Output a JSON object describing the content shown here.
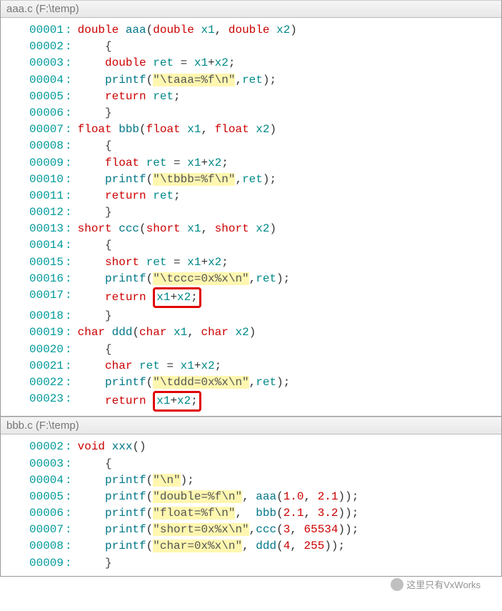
{
  "files": [
    {
      "header": "aaa.c (F:\\temp)",
      "lines": [
        {
          "n": "00001",
          "tokens": [
            {
              "t": "kw",
              "v": "double "
            },
            {
              "t": "fn",
              "v": "aaa"
            },
            {
              "t": "plain",
              "v": "("
            },
            {
              "t": "kw",
              "v": "double "
            },
            {
              "t": "param",
              "v": "x1"
            },
            {
              "t": "plain",
              "v": ", "
            },
            {
              "t": "kw",
              "v": "double "
            },
            {
              "t": "param",
              "v": "x2"
            },
            {
              "t": "plain",
              "v": ")"
            }
          ],
          "indent": 0
        },
        {
          "n": "00002",
          "tokens": [
            {
              "t": "brace",
              "v": "{"
            }
          ],
          "indent": 1
        },
        {
          "n": "00003",
          "tokens": [
            {
              "t": "kw",
              "v": "double "
            },
            {
              "t": "param",
              "v": "ret"
            },
            {
              "t": "plain",
              "v": " = "
            },
            {
              "t": "param",
              "v": "x1"
            },
            {
              "t": "plain",
              "v": "+"
            },
            {
              "t": "param",
              "v": "x2"
            },
            {
              "t": "plain",
              "v": ";"
            }
          ],
          "indent": 1
        },
        {
          "n": "00004",
          "tokens": [
            {
              "t": "fn",
              "v": "printf"
            },
            {
              "t": "plain",
              "v": "("
            },
            {
              "t": "str",
              "v": "\"\\taaa=%f\\n\""
            },
            {
              "t": "plain",
              "v": ","
            },
            {
              "t": "param",
              "v": "ret"
            },
            {
              "t": "plain",
              "v": ");"
            }
          ],
          "indent": 1
        },
        {
          "n": "00005",
          "tokens": [
            {
              "t": "kw",
              "v": "return "
            },
            {
              "t": "param",
              "v": "ret"
            },
            {
              "t": "plain",
              "v": ";"
            }
          ],
          "indent": 1
        },
        {
          "n": "00006",
          "tokens": [
            {
              "t": "brace",
              "v": "}"
            }
          ],
          "indent": 1
        },
        {
          "n": "00007",
          "tokens": [
            {
              "t": "kw",
              "v": "float "
            },
            {
              "t": "fn",
              "v": "bbb"
            },
            {
              "t": "plain",
              "v": "("
            },
            {
              "t": "kw",
              "v": "float "
            },
            {
              "t": "param",
              "v": "x1"
            },
            {
              "t": "plain",
              "v": ", "
            },
            {
              "t": "kw",
              "v": "float "
            },
            {
              "t": "param",
              "v": "x2"
            },
            {
              "t": "plain",
              "v": ")"
            }
          ],
          "indent": 0
        },
        {
          "n": "00008",
          "tokens": [
            {
              "t": "brace",
              "v": "{"
            }
          ],
          "indent": 1
        },
        {
          "n": "00009",
          "tokens": [
            {
              "t": "kw",
              "v": "float "
            },
            {
              "t": "param",
              "v": "ret"
            },
            {
              "t": "plain",
              "v": " = "
            },
            {
              "t": "param",
              "v": "x1"
            },
            {
              "t": "plain",
              "v": "+"
            },
            {
              "t": "param",
              "v": "x2"
            },
            {
              "t": "plain",
              "v": ";"
            }
          ],
          "indent": 1
        },
        {
          "n": "00010",
          "tokens": [
            {
              "t": "fn",
              "v": "printf"
            },
            {
              "t": "plain",
              "v": "("
            },
            {
              "t": "str",
              "v": "\"\\tbbb=%f\\n\""
            },
            {
              "t": "plain",
              "v": ","
            },
            {
              "t": "param",
              "v": "ret"
            },
            {
              "t": "plain",
              "v": ");"
            }
          ],
          "indent": 1
        },
        {
          "n": "00011",
          "tokens": [
            {
              "t": "kw",
              "v": "return "
            },
            {
              "t": "param",
              "v": "ret"
            },
            {
              "t": "plain",
              "v": ";"
            }
          ],
          "indent": 1
        },
        {
          "n": "00012",
          "tokens": [
            {
              "t": "brace",
              "v": "}"
            }
          ],
          "indent": 1
        },
        {
          "n": "00013",
          "tokens": [
            {
              "t": "kw",
              "v": "short "
            },
            {
              "t": "fn",
              "v": "ccc"
            },
            {
              "t": "plain",
              "v": "("
            },
            {
              "t": "kw",
              "v": "short "
            },
            {
              "t": "param",
              "v": "x1"
            },
            {
              "t": "plain",
              "v": ", "
            },
            {
              "t": "kw",
              "v": "short "
            },
            {
              "t": "param",
              "v": "x2"
            },
            {
              "t": "plain",
              "v": ")"
            }
          ],
          "indent": 0
        },
        {
          "n": "00014",
          "tokens": [
            {
              "t": "brace",
              "v": "{"
            }
          ],
          "indent": 1
        },
        {
          "n": "00015",
          "tokens": [
            {
              "t": "kw",
              "v": "short "
            },
            {
              "t": "param",
              "v": "ret"
            },
            {
              "t": "plain",
              "v": " = "
            },
            {
              "t": "param",
              "v": "x1"
            },
            {
              "t": "plain",
              "v": "+"
            },
            {
              "t": "param",
              "v": "x2"
            },
            {
              "t": "plain",
              "v": ";"
            }
          ],
          "indent": 1
        },
        {
          "n": "00016",
          "tokens": [
            {
              "t": "fn",
              "v": "printf"
            },
            {
              "t": "plain",
              "v": "("
            },
            {
              "t": "str",
              "v": "\"\\tccc=0x%x\\n\""
            },
            {
              "t": "plain",
              "v": ","
            },
            {
              "t": "param",
              "v": "ret"
            },
            {
              "t": "plain",
              "v": ");"
            }
          ],
          "indent": 1
        },
        {
          "n": "00017",
          "tokens": [
            {
              "t": "kw",
              "v": "return "
            },
            {
              "t": "box",
              "inner": [
                {
                  "t": "param",
                  "v": "x1"
                },
                {
                  "t": "plain",
                  "v": "+"
                },
                {
                  "t": "param",
                  "v": "x2"
                },
                {
                  "t": "plain",
                  "v": ";"
                }
              ]
            }
          ],
          "indent": 1
        },
        {
          "n": "00018",
          "tokens": [
            {
              "t": "brace",
              "v": "}"
            }
          ],
          "indent": 1
        },
        {
          "n": "00019",
          "tokens": [
            {
              "t": "kw",
              "v": "char "
            },
            {
              "t": "fn",
              "v": "ddd"
            },
            {
              "t": "plain",
              "v": "("
            },
            {
              "t": "kw",
              "v": "char "
            },
            {
              "t": "param",
              "v": "x1"
            },
            {
              "t": "plain",
              "v": ", "
            },
            {
              "t": "kw",
              "v": "char "
            },
            {
              "t": "param",
              "v": "x2"
            },
            {
              "t": "plain",
              "v": ")"
            }
          ],
          "indent": 0
        },
        {
          "n": "00020",
          "tokens": [
            {
              "t": "brace",
              "v": "{"
            }
          ],
          "indent": 1
        },
        {
          "n": "00021",
          "tokens": [
            {
              "t": "kw",
              "v": "char "
            },
            {
              "t": "param",
              "v": "ret"
            },
            {
              "t": "plain",
              "v": " = "
            },
            {
              "t": "param",
              "v": "x1"
            },
            {
              "t": "plain",
              "v": "+"
            },
            {
              "t": "param",
              "v": "x2"
            },
            {
              "t": "plain",
              "v": ";"
            }
          ],
          "indent": 1
        },
        {
          "n": "00022",
          "tokens": [
            {
              "t": "fn",
              "v": "printf"
            },
            {
              "t": "plain",
              "v": "("
            },
            {
              "t": "str",
              "v": "\"\\tddd=0x%x\\n\""
            },
            {
              "t": "plain",
              "v": ","
            },
            {
              "t": "param",
              "v": "ret"
            },
            {
              "t": "plain",
              "v": ");"
            }
          ],
          "indent": 1
        },
        {
          "n": "00023",
          "tokens": [
            {
              "t": "kw",
              "v": "return "
            },
            {
              "t": "box",
              "inner": [
                {
                  "t": "param",
                  "v": "x1"
                },
                {
                  "t": "plain",
                  "v": "+"
                },
                {
                  "t": "param",
                  "v": "x2"
                },
                {
                  "t": "plain",
                  "v": ";"
                }
              ]
            }
          ],
          "indent": 1
        }
      ]
    },
    {
      "header": "bbb.c (F:\\temp)",
      "lines": [
        {
          "n": "00002",
          "tokens": [
            {
              "t": "kw",
              "v": "void "
            },
            {
              "t": "fn",
              "v": "xxx"
            },
            {
              "t": "plain",
              "v": "()"
            }
          ],
          "indent": 0
        },
        {
          "n": "00003",
          "tokens": [
            {
              "t": "brace",
              "v": "{"
            }
          ],
          "indent": 1
        },
        {
          "n": "00004",
          "tokens": [
            {
              "t": "fn",
              "v": "printf"
            },
            {
              "t": "plain",
              "v": "("
            },
            {
              "t": "str",
              "v": "\"\\n\""
            },
            {
              "t": "plain",
              "v": ");"
            }
          ],
          "indent": 1
        },
        {
          "n": "00005",
          "tokens": [
            {
              "t": "fn",
              "v": "printf"
            },
            {
              "t": "plain",
              "v": "("
            },
            {
              "t": "str",
              "v": "\"double=%f\\n\""
            },
            {
              "t": "plain",
              "v": ", "
            },
            {
              "t": "fn",
              "v": "aaa"
            },
            {
              "t": "plain",
              "v": "("
            },
            {
              "t": "num",
              "v": "1.0"
            },
            {
              "t": "plain",
              "v": ", "
            },
            {
              "t": "num",
              "v": "2.1"
            },
            {
              "t": "plain",
              "v": "));"
            }
          ],
          "indent": 1
        },
        {
          "n": "00006",
          "tokens": [
            {
              "t": "fn",
              "v": "printf"
            },
            {
              "t": "plain",
              "v": "("
            },
            {
              "t": "str",
              "v": "\"float=%f\\n\""
            },
            {
              "t": "plain",
              "v": ",  "
            },
            {
              "t": "fn",
              "v": "bbb"
            },
            {
              "t": "plain",
              "v": "("
            },
            {
              "t": "num",
              "v": "2.1"
            },
            {
              "t": "plain",
              "v": ", "
            },
            {
              "t": "num",
              "v": "3.2"
            },
            {
              "t": "plain",
              "v": "));"
            }
          ],
          "indent": 1
        },
        {
          "n": "00007",
          "tokens": [
            {
              "t": "fn",
              "v": "printf"
            },
            {
              "t": "plain",
              "v": "("
            },
            {
              "t": "str",
              "v": "\"short=0x%x\\n\""
            },
            {
              "t": "plain",
              "v": ","
            },
            {
              "t": "fn",
              "v": "ccc"
            },
            {
              "t": "plain",
              "v": "("
            },
            {
              "t": "num",
              "v": "3"
            },
            {
              "t": "plain",
              "v": ", "
            },
            {
              "t": "num",
              "v": "65534"
            },
            {
              "t": "plain",
              "v": "));"
            }
          ],
          "indent": 1
        },
        {
          "n": "00008",
          "tokens": [
            {
              "t": "fn",
              "v": "printf"
            },
            {
              "t": "plain",
              "v": "("
            },
            {
              "t": "str",
              "v": "\"char=0x%x\\n\""
            },
            {
              "t": "plain",
              "v": ", "
            },
            {
              "t": "fn",
              "v": "ddd"
            },
            {
              "t": "plain",
              "v": "("
            },
            {
              "t": "num",
              "v": "4"
            },
            {
              "t": "plain",
              "v": ", "
            },
            {
              "t": "num",
              "v": "255"
            },
            {
              "t": "plain",
              "v": "));"
            }
          ],
          "indent": 1
        },
        {
          "n": "00009",
          "tokens": [
            {
              "t": "brace",
              "v": "}"
            }
          ],
          "indent": 1
        }
      ]
    }
  ],
  "watermark": "这里只有VxWorks"
}
